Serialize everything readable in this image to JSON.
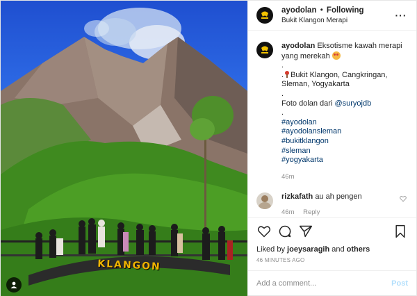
{
  "post": {
    "username": "ayodolan",
    "follow_status": "Following",
    "separator": "•",
    "location": "Bukit Klangon Merapi",
    "more_icon": "more-options-icon",
    "photo_sign_text": "KLANGON",
    "avatar_logo_text": "Ayo Dolan"
  },
  "caption": {
    "username": "ayodolan",
    "text": "Eksotisme kawah merapi yang merekah",
    "emoji": "heart-eyes-emoji",
    "dot1": ".",
    "location_line": "Bukit Klangon, Cangkringan, Sleman, Yogyakarta",
    "location_prefix": ".",
    "dot2": ".",
    "credit_text": "Foto dolan dari",
    "credit_user": "@suryojdb",
    "dot3": ".",
    "hashtags": [
      "#ayodolan",
      "#ayodolansleman",
      "#bukitklangon",
      "#sleman",
      "#yogyakarta"
    ],
    "time": "46m"
  },
  "comment": {
    "username": "rizkafath",
    "text": "au ah pengen",
    "time": "46m",
    "reply_label": "Reply"
  },
  "actions": {
    "likes_prefix": "Liked by",
    "liked_user": "joeysaragih",
    "likes_and": "and",
    "likes_others": "others",
    "posted_ago": "46 MINUTES AGO"
  },
  "add_comment": {
    "placeholder": "Add a comment...",
    "post_label": "Post",
    "post_color": "#b2dffc"
  },
  "colors": {
    "hashtag": "#00376b",
    "meta_gray": "#8e8e8e",
    "text": "#262626"
  }
}
